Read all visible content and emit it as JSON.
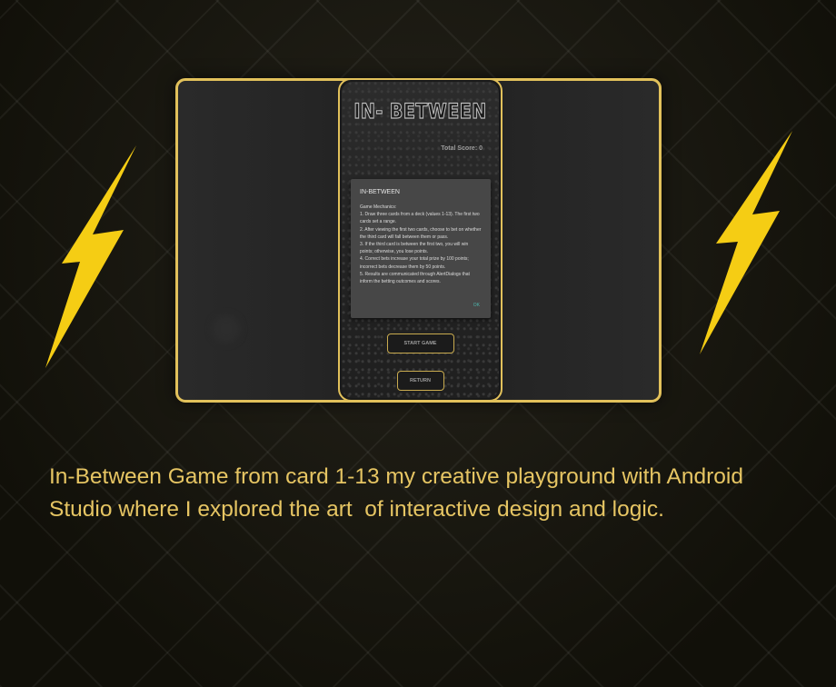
{
  "colors": {
    "accent_gold": "#e2c15b",
    "bolt_yellow": "#f5cd14",
    "dialog_ok": "#4db6ac",
    "caption": "#e6c563"
  },
  "game": {
    "title": "IN- BETWEEN",
    "total_score": "Total Score: 0",
    "dialog": {
      "title": "IN-BETWEEN",
      "body_lines": [
        "Game Mechanics:",
        "1. Draw three cards from a deck (values 1-13). The first two cards set a range.",
        "2. After viewing the first two cards, choose to bet on whether the third card will fall between them or pass.",
        "3. If the third card is between the first two, you will win points; otherwise, you lose points.",
        "4. Correct bets increase your total prize by 100 points; incorrect bets decrease them by 50 points.",
        "5. Results are communicated through AlertDialogs that inform the betting outcomes and scores."
      ],
      "ok_label": "OK"
    },
    "start_label": "START GAME",
    "return_label": "RETURN"
  },
  "icons": {
    "left_bolt": "lightning-bolt-icon",
    "right_bolt": "lightning-bolt-icon"
  },
  "caption": "In-Between Game from card 1-13 my creative playground with Android Studio where I explored the art  of interactive design and logic."
}
